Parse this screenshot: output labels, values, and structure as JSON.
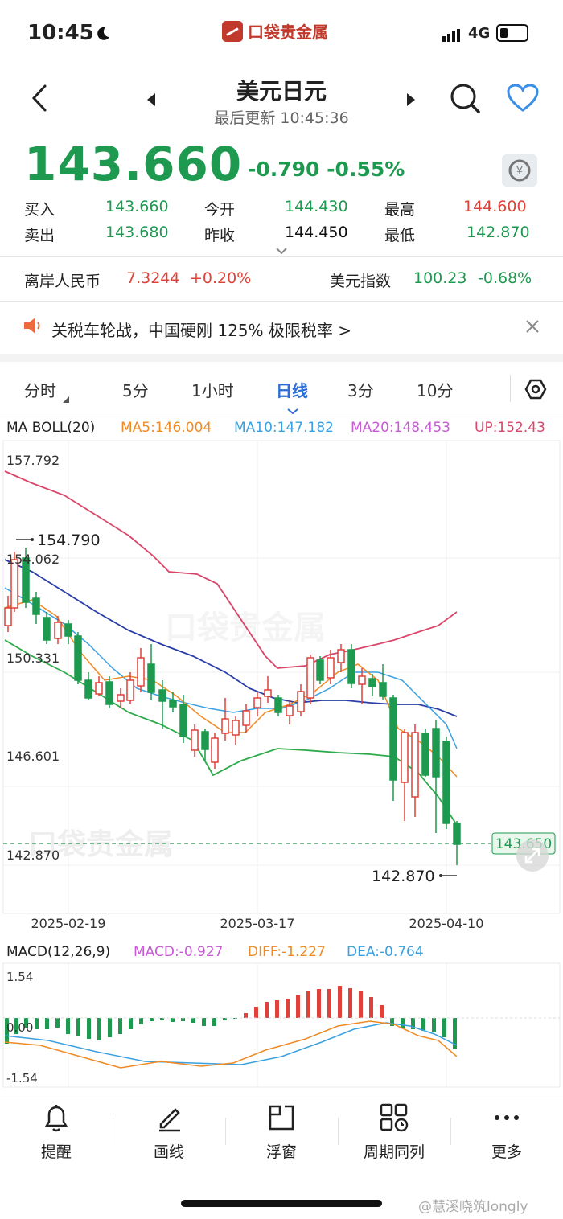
{
  "status": {
    "time": "10:45",
    "brand": "口袋贵金属",
    "network": "4G"
  },
  "nav": {
    "title": "美元日元",
    "updated": "最后更新 10:45:36"
  },
  "quote": {
    "price": "143.660",
    "change": "-0.790",
    "change_pct": "-0.55%",
    "buy_label": "买入",
    "buy": "143.660",
    "sell_label": "卖出",
    "sell": "143.680",
    "open_label": "今开",
    "open": "144.430",
    "prev_label": "昨收",
    "prev": "144.450",
    "high_label": "最高",
    "high": "144.600",
    "low_label": "最低",
    "low": "142.870"
  },
  "related": {
    "cnh_label": "离岸人民币",
    "cnh_value": "7.3244",
    "cnh_change": "+0.20%",
    "dxy_label": "美元指数",
    "dxy_value": "100.23",
    "dxy_change": "-0.68%"
  },
  "news": {
    "text": "关税车轮战，中国硬刚 125% 极限税率 >"
  },
  "tabs": [
    "分时",
    "5分",
    "1小时",
    "日线",
    "3分",
    "10分"
  ],
  "active_tab": "日线",
  "main_chart": {
    "indicator": "MA BOLL(20)",
    "ma5": "MA5:146.004",
    "ma10": "MA10:147.182",
    "ma20": "MA20:148.453",
    "up": "UP:152.43",
    "y_labels": [
      "157.792",
      "154.062",
      "150.331",
      "146.601",
      "142.870"
    ],
    "max_marker": "154.790",
    "min_marker": "142.870",
    "current_price": "143.650",
    "x_labels": [
      "2025-02-19",
      "2025-03-17",
      "2025-04-10"
    ],
    "watermark": "口袋贵金属",
    "colors": {
      "up": "#e0413a",
      "down": "#1d9a4f",
      "ma5": "#f08a24",
      "ma10": "#3aa0e0",
      "ma20": "#2a3ea8",
      "upper": "#d9466a",
      "lower": "#2eaa4a"
    }
  },
  "macd": {
    "title": "MACD(12,26,9)",
    "macd": "MACD:-0.927",
    "diff": "DIFF:-1.227",
    "dea": "DEA:-0.764",
    "y_labels": [
      "1.54",
      "0.00",
      "-1.54"
    ]
  },
  "bottom": [
    "提醒",
    "画线",
    "浮窗",
    "周期同列",
    "更多"
  ],
  "credit": "@慧溪晓筑longly"
}
